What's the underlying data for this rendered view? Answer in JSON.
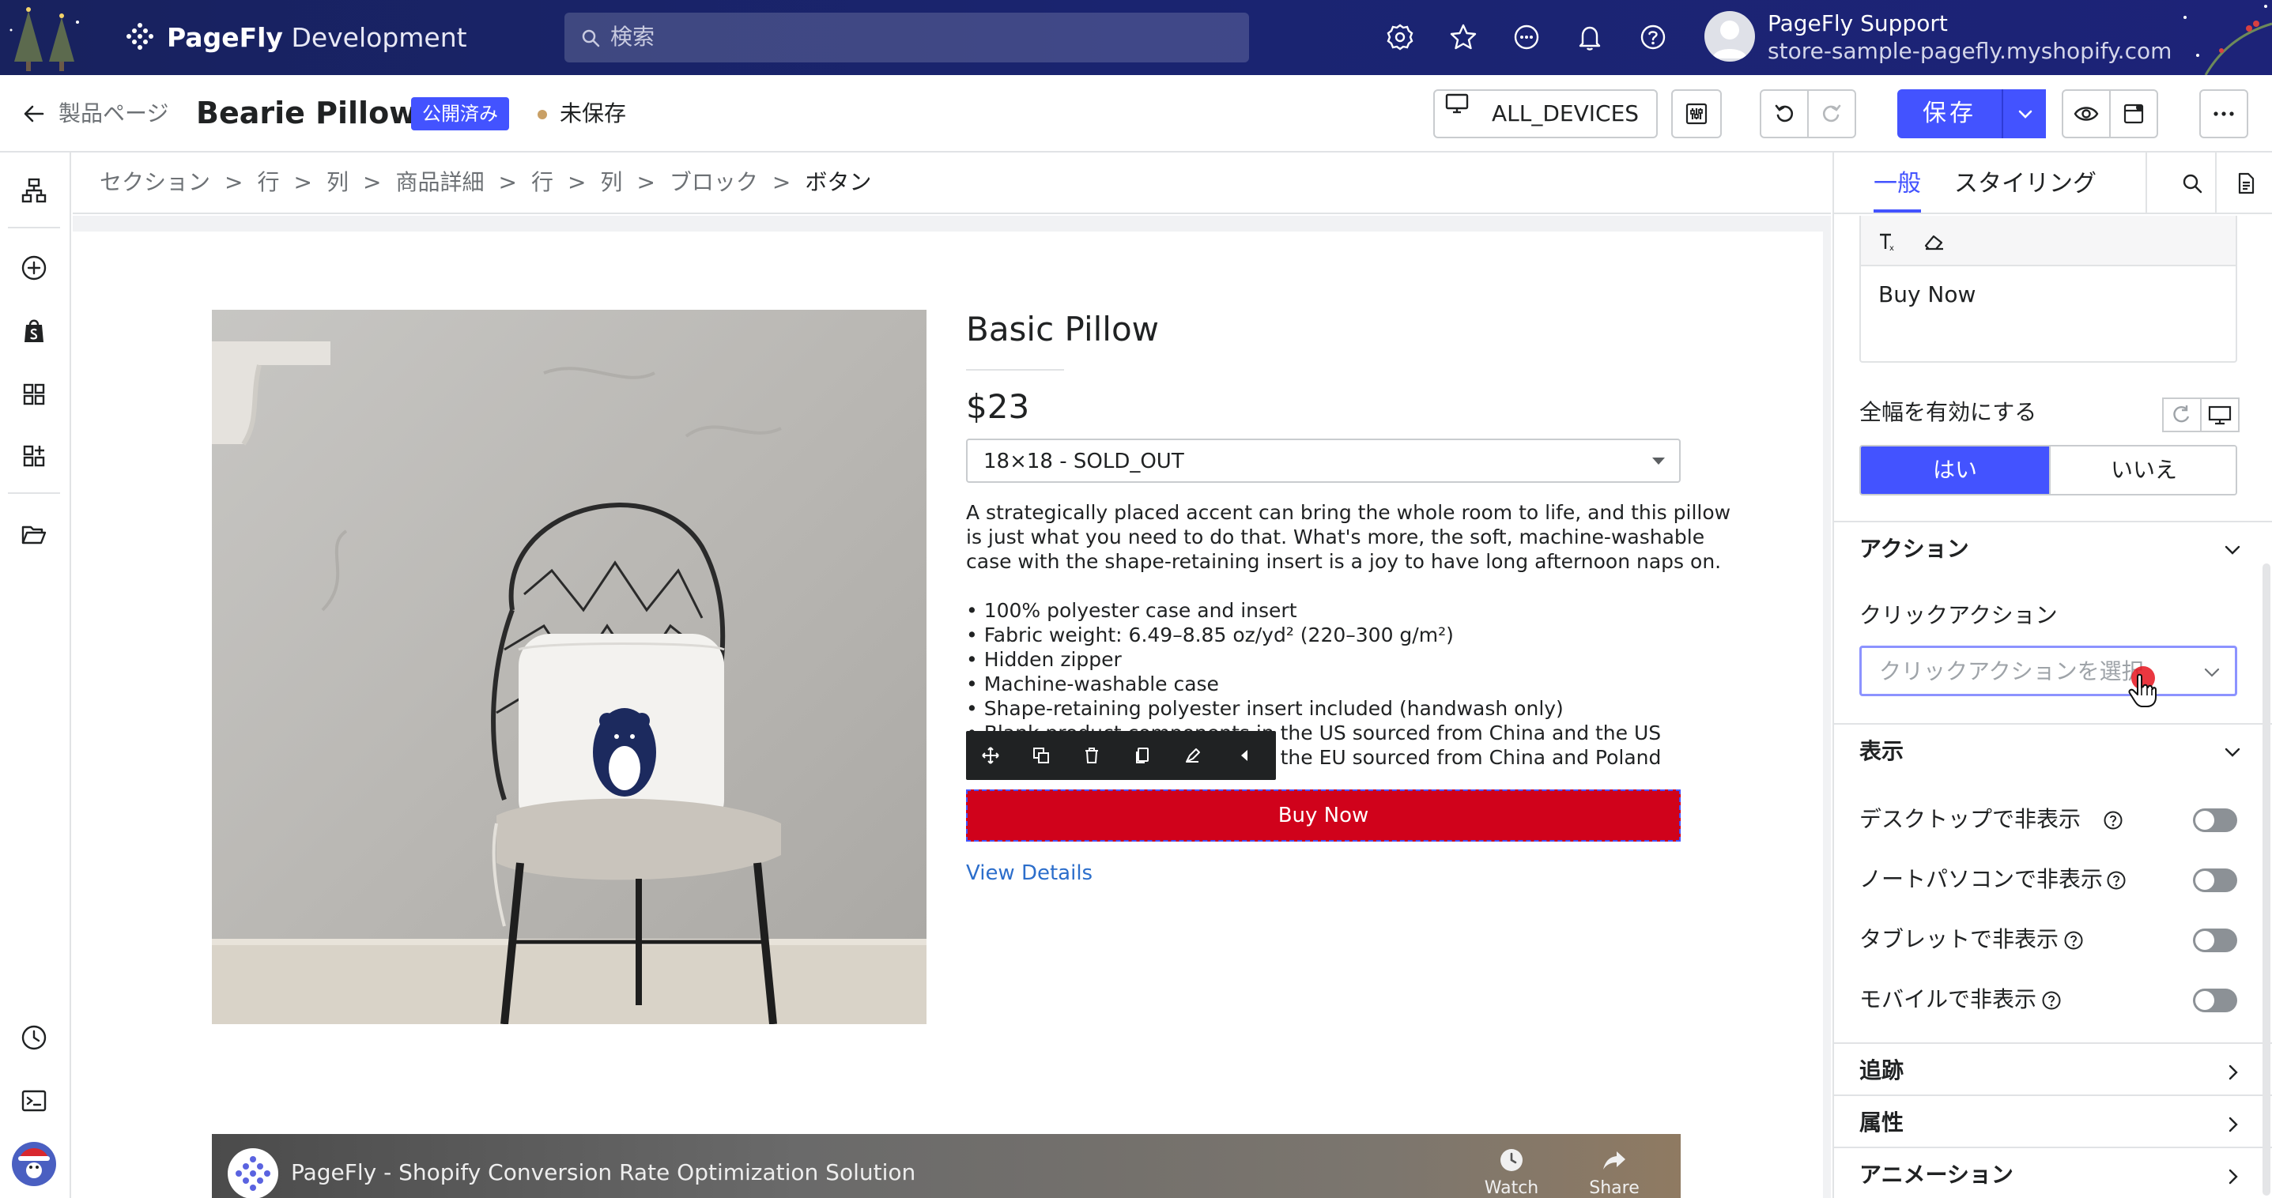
{
  "topbar": {
    "brand": "PageFly",
    "brand_suffix": "Development",
    "search_placeholder": "検索",
    "user_name": "PageFly Support",
    "user_store": "store-sample-pagefly.myshopify.com",
    "icons": [
      "settings-icon",
      "star-icon",
      "chat-icon",
      "bell-icon",
      "help-icon"
    ]
  },
  "header": {
    "back_label": "製品ページ",
    "page_title": "Bearie Pillow",
    "status_badge": "公開済み",
    "unsaved": "未保存",
    "devices": "ALL_DEVICES",
    "save": "保存"
  },
  "breadcrumb": [
    "セクション",
    "行",
    "列",
    "商品詳細",
    "行",
    "列",
    "ブロック",
    "ボタン"
  ],
  "product": {
    "title": "Basic Pillow",
    "price": "$23",
    "variant": "18×18 - SOLD_OUT",
    "description": [
      "A strategically placed accent can bring the whole room to life, and this pillow",
      "is just what you need to do that. What's more, the soft, machine-washable",
      "case with the shape-retaining insert is a joy to have long afternoon naps on."
    ],
    "bullets": [
      "• 100% polyester case and insert",
      "• Fabric weight: 6.49–8.85 oz/yd² (220–300 g/m²)",
      "• Hidden zipper",
      "• Machine-washable case",
      "• Shape-retaining polyester insert included (handwash only)",
      "• Blank product components in the US sourced from China and the US",
      "• Blank product components in the EU sourced from China and Poland"
    ],
    "buy_button": "Buy Now",
    "view_details": "View Details"
  },
  "video": {
    "title": "PageFly - Shopify Conversion Rate Optimization Solution",
    "watch_later": "Watch later",
    "share": "Share"
  },
  "panel": {
    "tab_general": "一般",
    "tab_styling": "スタイリング",
    "button_text": "Buy Now",
    "full_width_label": "全幅を有効にする",
    "yes": "はい",
    "no": "いいえ",
    "section_action": "アクション",
    "click_action_label": "クリックアクション",
    "click_action_placeholder": "クリックアクションを選択",
    "section_display": "表示",
    "hide_desktop": "デスクトップで非表示",
    "hide_laptop": "ノートパソコンで非表示",
    "hide_tablet": "タブレットで非表示",
    "hide_mobile": "モバイルで非表示",
    "section_tracking": "追跡",
    "section_attributes": "属性",
    "section_animation": "アニメーション"
  },
  "colors": {
    "accent": "#4353ff",
    "buy_button": "#d0021b",
    "topbar": "#1a2470",
    "link": "#2c6ecb"
  }
}
